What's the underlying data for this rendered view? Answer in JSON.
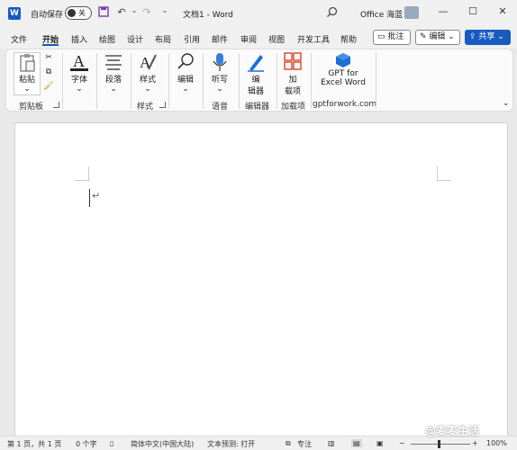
{
  "titlebar": {
    "app_logo": "W",
    "autosave_label": "自动保存",
    "autosave_state": "关",
    "doc_title": "文档1  -  Word",
    "user_name": "Office 海蓝",
    "icons": [
      "save-icon",
      "undo-icon",
      "redo-icon",
      "customize-icon",
      "search-icon",
      "minimize-icon",
      "maximize-icon",
      "close-icon"
    ],
    "minimize": "—",
    "maximize": "☐",
    "close": "✕"
  },
  "tabs": [
    "文件",
    "开始",
    "插入",
    "绘图",
    "设计",
    "布局",
    "引用",
    "邮件",
    "审阅",
    "视图",
    "开发工具",
    "帮助"
  ],
  "active_tab": "开始",
  "accent_color": "#185abd",
  "actions": {
    "comment": "批注",
    "edit": "编辑",
    "share": "共享"
  },
  "ribbon": {
    "paste": "粘贴",
    "clipboard_group": "剪贴板",
    "font": "字体",
    "paragraph": "段落",
    "styles": "样式",
    "styles_group": "样式",
    "editing": "编辑",
    "dictate": "听写",
    "voice_group": "语音",
    "editor_line1": "编",
    "editor_line2": "辑器",
    "editor_group": "编辑器",
    "addins_line1": "加",
    "addins_line2": "载项",
    "addins_group": "加载项",
    "gpt_line1": "GPT for",
    "gpt_line2": "Excel Word",
    "gpt_group": "gptforwork.com",
    "dropdown": "⌄"
  },
  "document": {
    "paragraph_mark": "↵"
  },
  "statusbar": {
    "page": "第 1 页，共 1 页",
    "words": "0 个字",
    "language": "简体中文(中国大陆)",
    "prediction": "文本预测: 打开",
    "focus": "专注",
    "zoom": "100%",
    "zoom_minus": "−",
    "zoom_plus": "+"
  },
  "watermark": "@麦麦生活"
}
